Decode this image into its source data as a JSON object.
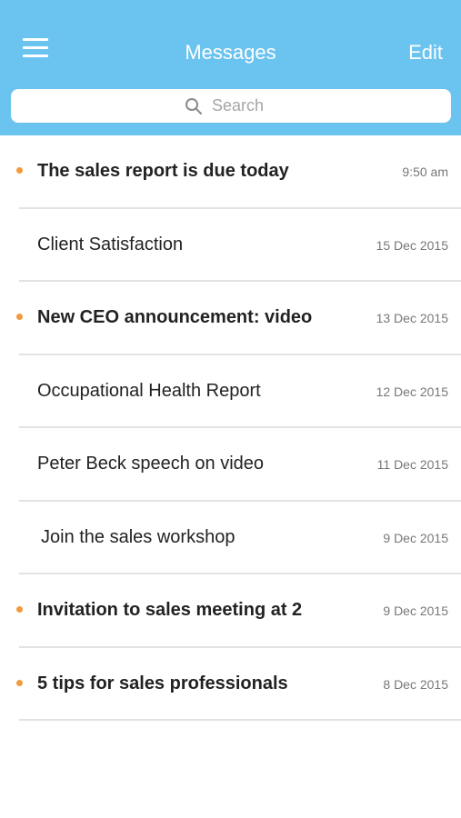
{
  "header": {
    "title": "Messages",
    "edit_label": "Edit",
    "menu_icon": "hamburger-menu-icon",
    "background_color": "#6bc3ef"
  },
  "search": {
    "placeholder": "Search",
    "icon": "search-icon"
  },
  "unread_dot_color": "#f29a3d",
  "messages": [
    {
      "subject": "The sales report is due today",
      "date": "9:50 am",
      "unread": true
    },
    {
      "subject": "Client Satisfaction",
      "date": "15 Dec 2015",
      "unread": false
    },
    {
      "subject": "New CEO announcement: video",
      "date": "13 Dec 2015",
      "unread": true
    },
    {
      "subject": "Occupational Health Report",
      "date": "12 Dec 2015",
      "unread": false
    },
    {
      "subject": "Peter Beck speech on video",
      "date": "11 Dec 2015",
      "unread": false
    },
    {
      "subject": "Join the sales workshop",
      "date": "9 Dec 2015",
      "unread": false
    },
    {
      "subject": "Invitation to sales meeting at 2",
      "date": "9 Dec 2015",
      "unread": true
    },
    {
      "subject": "5 tips for sales professionals",
      "date": "8 Dec 2015",
      "unread": true
    }
  ]
}
